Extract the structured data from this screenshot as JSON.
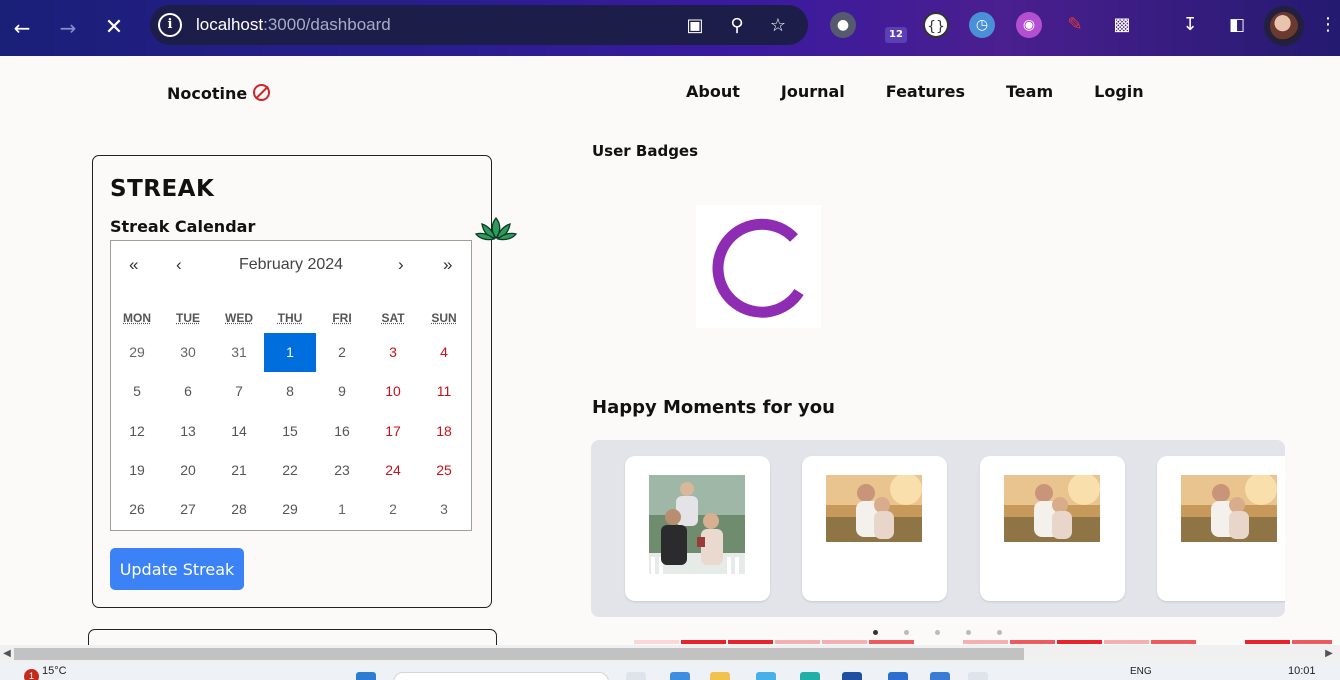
{
  "browser": {
    "url_host": "localhost",
    "url_path": ":3000/dashboard",
    "tab_count_badge": "12"
  },
  "navbar": {
    "brand": "Nocotine",
    "links": [
      "About",
      "Journal",
      "Features",
      "Team",
      "Login"
    ]
  },
  "streak": {
    "title": "STREAK",
    "subtitle": "Streak Calendar",
    "calendar": {
      "nav": {
        "prev_year": "«",
        "prev_month": "‹",
        "next_month": "›",
        "next_year": "»"
      },
      "month_label": "February 2024",
      "weekdays": [
        "MON",
        "TUE",
        "WED",
        "THU",
        "FRI",
        "SAT",
        "SUN"
      ],
      "weeks": [
        [
          "29",
          "30",
          "31",
          "1",
          "2",
          "3",
          "4"
        ],
        [
          "5",
          "6",
          "7",
          "8",
          "9",
          "10",
          "11"
        ],
        [
          "12",
          "13",
          "14",
          "15",
          "16",
          "17",
          "18"
        ],
        [
          "19",
          "20",
          "21",
          "22",
          "23",
          "24",
          "25"
        ],
        [
          "26",
          "27",
          "28",
          "29",
          "1",
          "2",
          "3"
        ]
      ],
      "selected_day": "1"
    },
    "button_label": "Update Streak"
  },
  "badges": {
    "title": "User Badges",
    "badge_color": "#8e2cb4"
  },
  "moments": {
    "title": "Happy Moments for you",
    "slide_count": 4,
    "dot_count": 5,
    "active_dot": 0
  },
  "taskbar": {
    "weather": "15°C",
    "notification_count": "1",
    "language": "ENG",
    "time": "10:01"
  },
  "colors": {
    "accent_button": "#3b82f6",
    "calendar_selected": "#006edc",
    "weekend": "#c8121a"
  }
}
